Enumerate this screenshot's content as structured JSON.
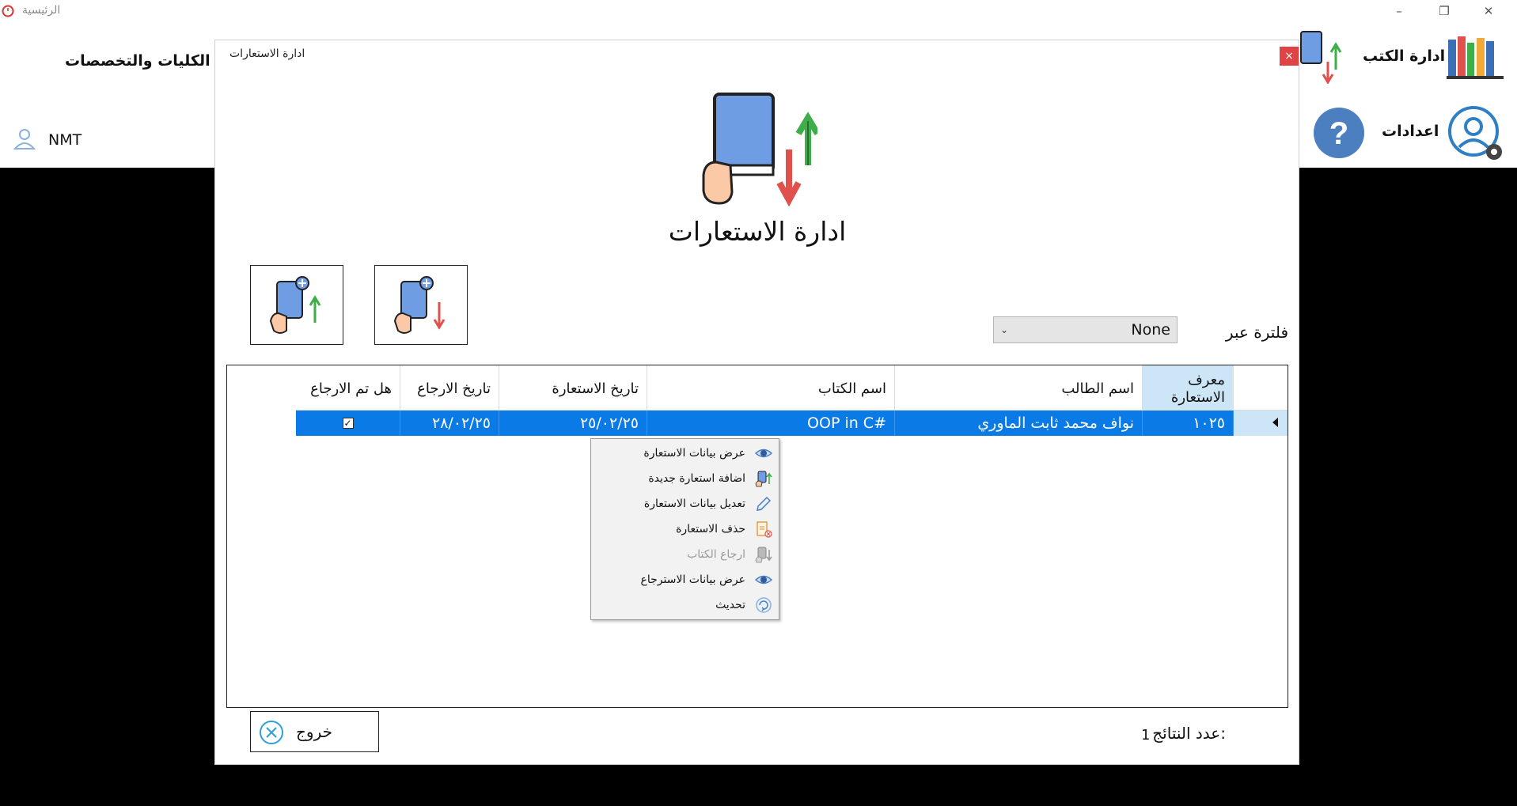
{
  "window": {
    "title": "الرئيسية",
    "min_glyph": "–",
    "max_glyph": "❐",
    "close_glyph": "✕"
  },
  "main": {
    "books_mgmt_label": "ادارة الكتب",
    "colleges_label": "رة الكليات والتخصصات",
    "settings_label": "اعدادات",
    "user_name": "NMT"
  },
  "dialog": {
    "title": "ادارة الاستعارات",
    "close_glyph": "×",
    "heading": "ادارة الاستعارات",
    "filter_label": "فلترة عبر",
    "filter_value": "None",
    "filter_chevron": "⌄",
    "exit_label": "خروج",
    "results_label": "عدد النتائج:",
    "results_count": "1"
  },
  "grid": {
    "columns": {
      "id": "معرف الاستعارة",
      "student": "اسم الطالب",
      "book": "اسم الكتاب",
      "borrow_date": "تاريخ الاستعارة",
      "return_date": "تاريخ الارجاع",
      "returned": "هل تم الارجاع"
    },
    "rows": [
      {
        "id": "١٠٢٥",
        "student": "نواف محمد ثابت الماوري",
        "book": "OOP in C#",
        "borrow_date": "٢٥/٠٢/٢٥",
        "return_date": "٢٨/٠٢/٢٥",
        "returned": "✓"
      }
    ]
  },
  "context_menu": {
    "items": [
      {
        "label": "عرض بيانات الاستعارة",
        "icon": "eye-icon",
        "enabled": true
      },
      {
        "label": "اضافة استعارة جديدة",
        "icon": "add-borrow-icon",
        "enabled": true
      },
      {
        "label": "تعديل بيانات الاستعارة",
        "icon": "pencil-icon",
        "enabled": true
      },
      {
        "label": "حذف الاستعارة",
        "icon": "delete-icon",
        "enabled": true
      },
      {
        "label": "ارجاع الكتاب",
        "icon": "return-book-icon",
        "enabled": false
      },
      {
        "label": "عرض بيانات الاسترجاع",
        "icon": "eye-icon",
        "enabled": true
      },
      {
        "label": "تحديث",
        "icon": "refresh-icon",
        "enabled": true
      }
    ]
  },
  "colors": {
    "selection": "#0a7be6",
    "header_highlight": "#cde6f7",
    "book_blue": "#6f9de3",
    "arrow_green": "#3fae49",
    "arrow_red": "#e0504d",
    "close_red": "#e04343"
  }
}
